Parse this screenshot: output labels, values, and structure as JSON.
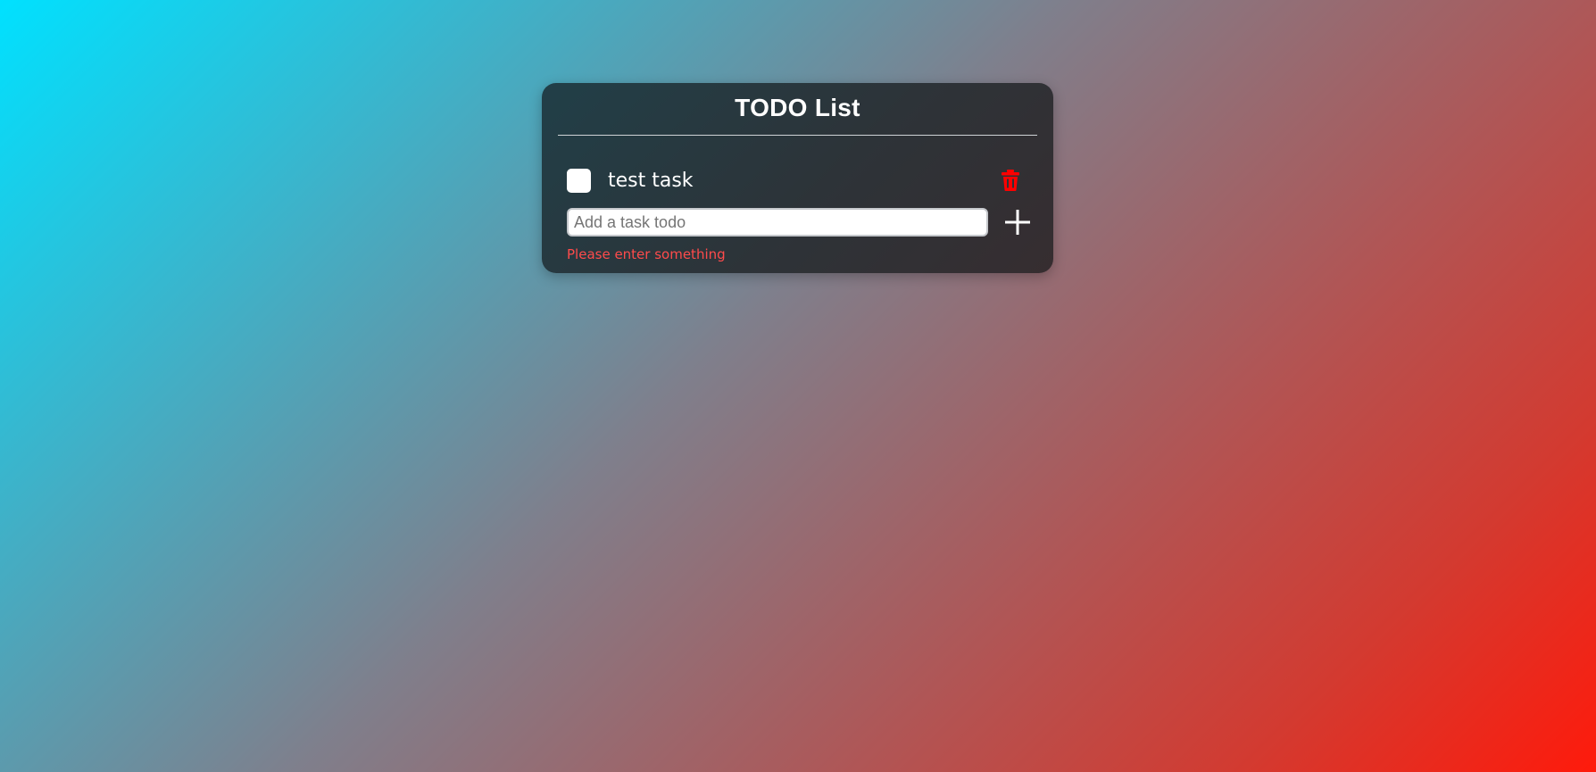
{
  "app": {
    "title": "TODO List"
  },
  "tasks": [
    {
      "label": "test task",
      "checked": false
    }
  ],
  "input": {
    "value": "",
    "placeholder": "Add a task todo"
  },
  "error": {
    "message": "Please enter something"
  },
  "icons": {
    "delete": "trash-icon",
    "add": "plus-icon"
  },
  "colors": {
    "delete_icon": "#ff0000",
    "error_text": "#ff4b4b",
    "card_background": "#2d3338"
  }
}
